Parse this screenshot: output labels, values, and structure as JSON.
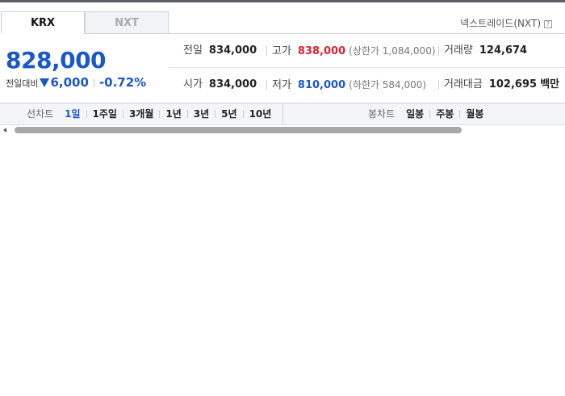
{
  "tabs": [
    {
      "label": "KRX",
      "active": true
    },
    {
      "label": "NXT",
      "active": false
    }
  ],
  "nxt_link": "넥스트레이드(NXT)",
  "help_icon_glyph": "?",
  "price": {
    "current": "828,000",
    "change_label": "전일대비",
    "change_value": "6,000",
    "change_percent": "-0.72%",
    "direction": "down"
  },
  "stats": {
    "prev_close": {
      "label": "전일",
      "value": "834,000"
    },
    "high": {
      "label": "고가",
      "value": "838,000",
      "sub": "(상한가 1,084,000)"
    },
    "volume": {
      "label": "거래량",
      "value": "124,674"
    },
    "open": {
      "label": "시가",
      "value": "834,000"
    },
    "low": {
      "label": "저가",
      "value": "810,000",
      "sub": "(하한가 584,000)"
    },
    "amount": {
      "label": "거래대금",
      "value": "102,695",
      "unit": "백만"
    }
  },
  "chart_tabs": {
    "line": {
      "title": "선차트",
      "items": [
        "1일",
        "1주일",
        "3개월",
        "1년",
        "3년",
        "5년",
        "10년"
      ],
      "selected": "1일"
    },
    "candle": {
      "title": "봉차트",
      "items": [
        "일봉",
        "주봉",
        "월봉"
      ]
    }
  },
  "colors": {
    "up": "#e0202a",
    "down": "#1a57c9"
  }
}
